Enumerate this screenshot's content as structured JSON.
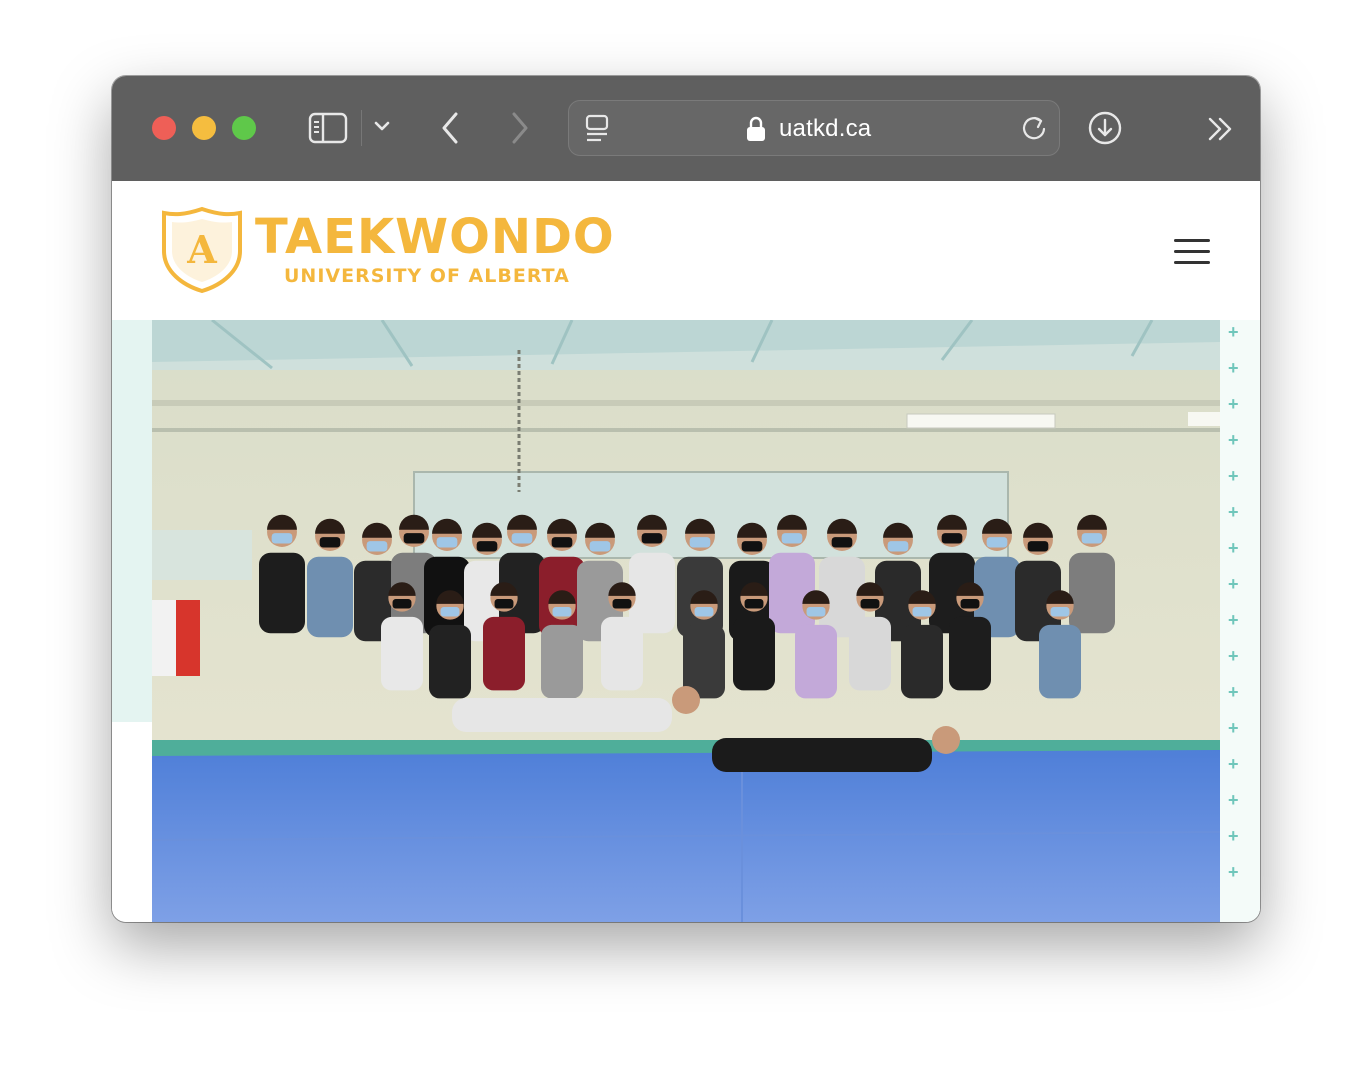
{
  "browser": {
    "url": "uatkd.ca",
    "icons": {
      "sidebar": "sidebar-icon",
      "dropdown": "chevron-down-icon",
      "back": "chevron-left-icon",
      "forward": "chevron-right-icon",
      "tab_overview": "tab-overview-icon",
      "lock": "lock-icon",
      "reload": "reload-icon",
      "download": "download-icon",
      "more": "double-chevron-right-icon"
    }
  },
  "site": {
    "logo": {
      "title": "TAEKWONDO",
      "subtitle": "UNIVERSITY OF ALBERTA",
      "emblem_letter": "A",
      "color": "#f4b73d"
    },
    "menu_icon": "hamburger-menu-icon",
    "hero": {
      "content": "group photo of taekwondo club members on blue mat"
    }
  }
}
